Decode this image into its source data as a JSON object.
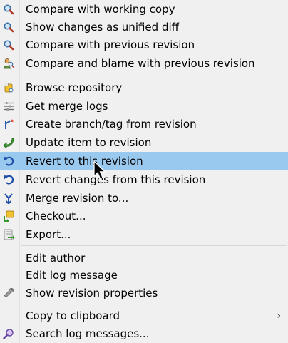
{
  "menu": {
    "items": [
      {
        "label": "Compare with working copy",
        "icon": "magnifier-icon"
      },
      {
        "label": "Show changes as unified diff",
        "icon": "magnifier-icon"
      },
      {
        "label": "Compare with previous revision",
        "icon": "magnifier-icon"
      },
      {
        "label": "Compare and blame with previous revision",
        "icon": "blame-icon"
      },
      {
        "label": "Browse repository",
        "icon": "repo-browser-icon"
      },
      {
        "label": "Get merge logs",
        "icon": "merge-logs-icon"
      },
      {
        "label": "Create branch/tag from revision",
        "icon": "branch-icon"
      },
      {
        "label": "Update item to revision",
        "icon": "update-arrow-icon"
      },
      {
        "label": "Revert to this revision",
        "icon": "revert-icon",
        "highlighted": true
      },
      {
        "label": "Revert changes from this revision",
        "icon": "revert-icon"
      },
      {
        "label": "Merge revision to...",
        "icon": "merge-icon"
      },
      {
        "label": "Checkout...",
        "icon": "checkout-icon"
      },
      {
        "label": "Export...",
        "icon": "export-icon"
      },
      {
        "label": "Edit author",
        "icon": ""
      },
      {
        "label": "Edit log message",
        "icon": ""
      },
      {
        "label": "Show revision properties",
        "icon": "wrench-icon"
      },
      {
        "label": "Copy to clipboard",
        "icon": "",
        "submenu": true
      },
      {
        "label": "Search log messages...",
        "icon": "search-icon"
      }
    ],
    "submenu_arrow": "›"
  },
  "colors": {
    "background": "#f0f0f0",
    "highlight": "#99c9ef",
    "separator": "#d7d7d7"
  }
}
